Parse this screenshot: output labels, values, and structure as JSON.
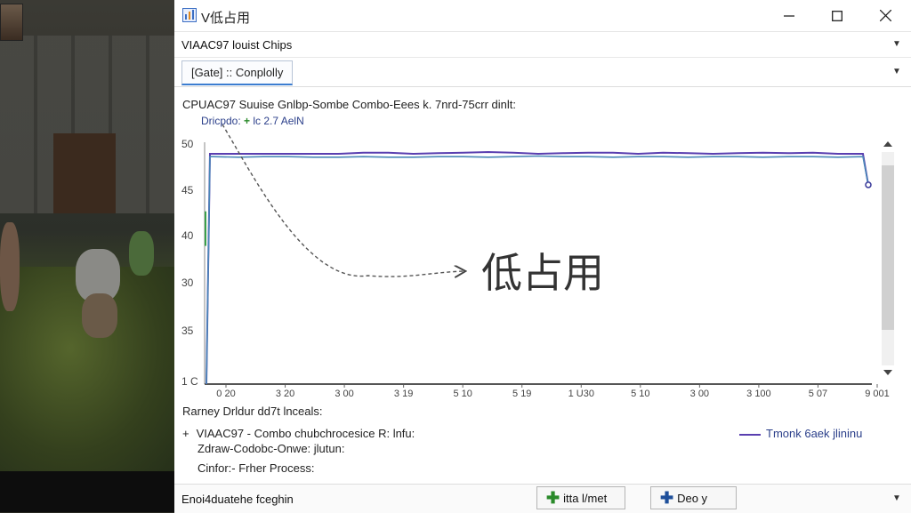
{
  "window": {
    "title": "V低占用",
    "process_selector": "VIAAC97 louist Chips",
    "tab_label": "[Gate] :: Conplolly"
  },
  "chart": {
    "title": "CPUAC97 Suuise Gnlbp-Sombe Combo-Eees k. 7nrd-75crr dinlt:",
    "subtitle_prefix": "Dricpdo: ",
    "subtitle_plus": "+",
    "subtitle_suffix": " lc 2.7 AelN",
    "annotation": "低占用"
  },
  "chart_data": {
    "type": "line",
    "y_tick_labels": [
      "50",
      "45",
      "40",
      "30",
      "35",
      "1 C"
    ],
    "x_tick_labels": [
      "0 20",
      "3 20",
      "3 00",
      "3 19",
      "5 10",
      "5 19",
      "1 U30",
      "5 10",
      "3 00",
      "3 100",
      "5 07",
      "9 001"
    ],
    "series": [
      {
        "name": "Tmonk 6aek jlininu",
        "color": "#5a3fb0",
        "values": [
          10,
          50,
          50,
          50,
          50,
          50,
          50,
          50,
          50.2,
          50.2,
          50,
          50.1,
          50.2,
          50.3,
          50.2,
          50,
          50.1,
          50.2,
          50.2,
          50,
          50.2,
          50.1,
          50,
          50.1,
          50.2,
          50.1,
          50.2,
          50,
          50,
          44.6
        ]
      },
      {
        "name": "",
        "color": "#4a88b8",
        "values": [
          10,
          49.5,
          49.5,
          49.4,
          49.5,
          49.5,
          49.4,
          49.4,
          49.5,
          49.4,
          49.4,
          49.5,
          49.5,
          49.4,
          49.5,
          49.6,
          49.5,
          49.5,
          49.4,
          49.5,
          49.5,
          49.4,
          49.5,
          49.5,
          49.4,
          49.5,
          49.5,
          49.4,
          49.5,
          44.6
        ]
      }
    ]
  },
  "details": {
    "title": "Rarney Drldur dd7t lnceals:",
    "main_row": "VIAAC97 - Combo chubchrocesice R: lnfu:",
    "sub_row1": "Zdraw-Codobc-Onwe: jlutun:",
    "sub_row2": "Cinfor:- Frher Process:",
    "legend_label": "Tmonk 6aek jlininu"
  },
  "bottom": {
    "status_text": "Enoi4duatehe fceghin",
    "button1": "itta l/met",
    "button2": "Deo y"
  },
  "colors": {
    "series_purple": "#5a3fb0",
    "series_blue": "#4a88b8",
    "accent_green": "#2a8a2a",
    "accent_blue": "#1e4f9a"
  }
}
